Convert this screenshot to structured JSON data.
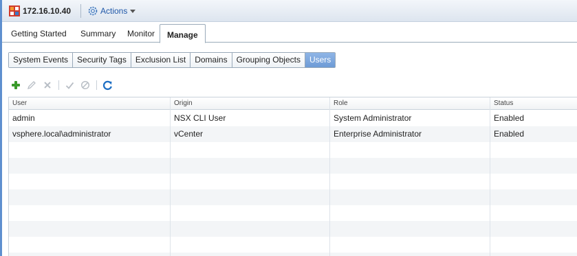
{
  "window": {
    "host": "172.16.10.40",
    "actions_label": "Actions"
  },
  "main_tabs": [
    "Getting Started",
    "Summary",
    "Monitor",
    "Manage"
  ],
  "main_tabs_active": "Manage",
  "sub_tabs": [
    "System Events",
    "Security Tags",
    "Exclusion List",
    "Domains",
    "Grouping Objects",
    "Users"
  ],
  "sub_tabs_active": "Users",
  "toolbar": {
    "icons": [
      "add-icon",
      "edit-icon",
      "delete-icon",
      "enable-icon",
      "disable-icon",
      "refresh-icon"
    ]
  },
  "table": {
    "columns": [
      "User",
      "Origin",
      "Role",
      "Status"
    ],
    "rows": [
      {
        "user": "admin",
        "origin": "NSX CLI User",
        "role": "System Administrator",
        "status": "Enabled"
      },
      {
        "user": "vsphere.local\\administrator",
        "origin": "vCenter",
        "role": "Enterprise Administrator",
        "status": "Enabled"
      }
    ]
  },
  "colors": {
    "accent": "#6d9bd6",
    "link": "#1f57a8",
    "add_green": "#3a9a2b",
    "refresh_blue": "#1e6fc4"
  }
}
